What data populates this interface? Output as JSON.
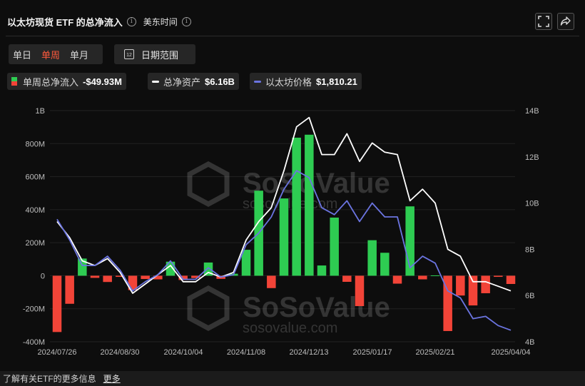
{
  "header": {
    "title": "以太坊现货 ETF 的总净流入",
    "info_glyph": "i",
    "timezone_label": "美东时间"
  },
  "period": {
    "options": [
      "单日",
      "单周",
      "单月"
    ],
    "active": "单周"
  },
  "date_range": {
    "label": "日期范围",
    "icon_text": "12"
  },
  "legend": {
    "items": [
      {
        "label": "单周总净流入",
        "value": "-$49.93M",
        "type": "bar"
      },
      {
        "label": "总净资产",
        "value": "$6.16B",
        "type": "line",
        "color": "#ffffff"
      },
      {
        "label": "以太坊价格",
        "value": "$1,810.21",
        "type": "line",
        "color": "#6b74e0"
      }
    ]
  },
  "colors": {
    "positive": "#2ecc52",
    "negative": "#f24438",
    "net_assets": "#ffffff",
    "eth_price": "#6b74e0"
  },
  "watermark": {
    "name": "SoSoValue",
    "url": "sosovalue.com"
  },
  "footer": {
    "text": "了解有关ETF的更多信息",
    "link": "更多"
  },
  "chart_data": {
    "type": "bar",
    "x_tick_labels": [
      "2024/07/26",
      "2024/08/30",
      "2024/10/04",
      "2024/11/08",
      "2024/12/13",
      "2025/01/17",
      "2025/02/21",
      "2025/04/04"
    ],
    "left_axis": {
      "ticks": [
        "1B",
        "800M",
        "600M",
        "400M",
        "200M",
        "0",
        "-200M",
        "-400M"
      ],
      "range": [
        -400,
        1000
      ],
      "unit": "M"
    },
    "right_axis": {
      "ticks": [
        "14B",
        "12B",
        "10B",
        "8B",
        "6B",
        "4B"
      ],
      "range": [
        4,
        14
      ],
      "unit": "B"
    },
    "series": [
      {
        "name": "单周总净流入",
        "type": "bar",
        "values": [
          -341,
          -170,
          104,
          -13,
          -38,
          -7,
          -87,
          -20,
          -22,
          85,
          -26,
          -14,
          80,
          -19,
          12,
          157,
          515,
          -75,
          468,
          836,
          854,
          62,
          352,
          -37,
          -184,
          215,
          139,
          -48,
          420,
          -22,
          2,
          -335,
          -120,
          -180,
          -106,
          -7,
          -50
        ]
      },
      {
        "name": "总净资产",
        "type": "line",
        "values": [
          9.2,
          8.5,
          7.5,
          7.3,
          7.6,
          7.0,
          6.1,
          6.5,
          6.9,
          7.3,
          6.6,
          6.6,
          7.0,
          6.8,
          7.0,
          8.4,
          9.2,
          9.8,
          11.4,
          13.3,
          13.7,
          12.1,
          12.1,
          13.0,
          11.8,
          12.6,
          12.2,
          12.1,
          10.1,
          10.6,
          10.0,
          8.0,
          7.7,
          6.6,
          6.6,
          6.4,
          6.2
        ]
      },
      {
        "name": "以太坊价格",
        "type": "line",
        "values": [
          9.3,
          8.4,
          7.3,
          7.3,
          7.7,
          7.1,
          6.2,
          6.6,
          6.9,
          7.5,
          6.7,
          6.7,
          7.2,
          6.8,
          6.9,
          8.2,
          8.7,
          9.4,
          10.6,
          11.4,
          11.1,
          9.8,
          9.5,
          10.1,
          9.2,
          10.0,
          9.4,
          9.4,
          7.2,
          7.7,
          7.4,
          6.2,
          5.9,
          5.0,
          5.1,
          4.7,
          4.5
        ]
      }
    ]
  }
}
